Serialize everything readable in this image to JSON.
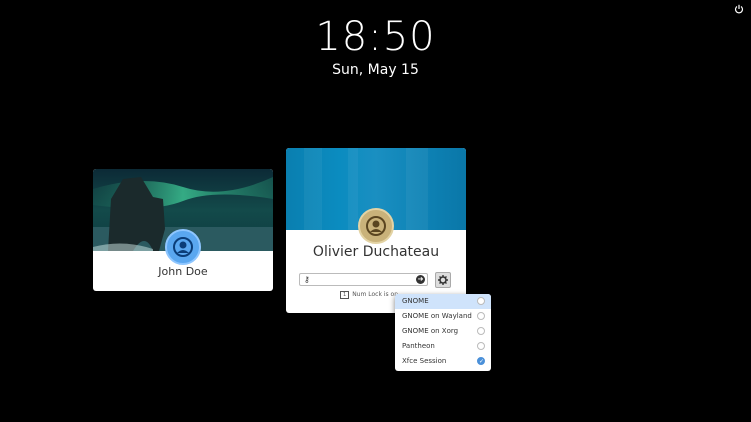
{
  "clock": {
    "time": "18:50",
    "date": "Sun, May 15"
  },
  "users": [
    {
      "name": "John Doe"
    },
    {
      "name": "Olivier Duchateau"
    }
  ],
  "login": {
    "password_placeholder": "",
    "numlock_text": "Num Lock is on",
    "numlock_badge": "1"
  },
  "sessions": {
    "items": [
      {
        "label": "GNOME",
        "selected": false
      },
      {
        "label": "GNOME on Wayland",
        "selected": false
      },
      {
        "label": "GNOME on Xorg",
        "selected": false
      },
      {
        "label": "Pantheon",
        "selected": false
      },
      {
        "label": "Xfce Session",
        "selected": true
      }
    ],
    "highlighted_index": 0
  },
  "colors": {
    "accent": "#4a90d9",
    "banner": "#0b8cc0"
  }
}
